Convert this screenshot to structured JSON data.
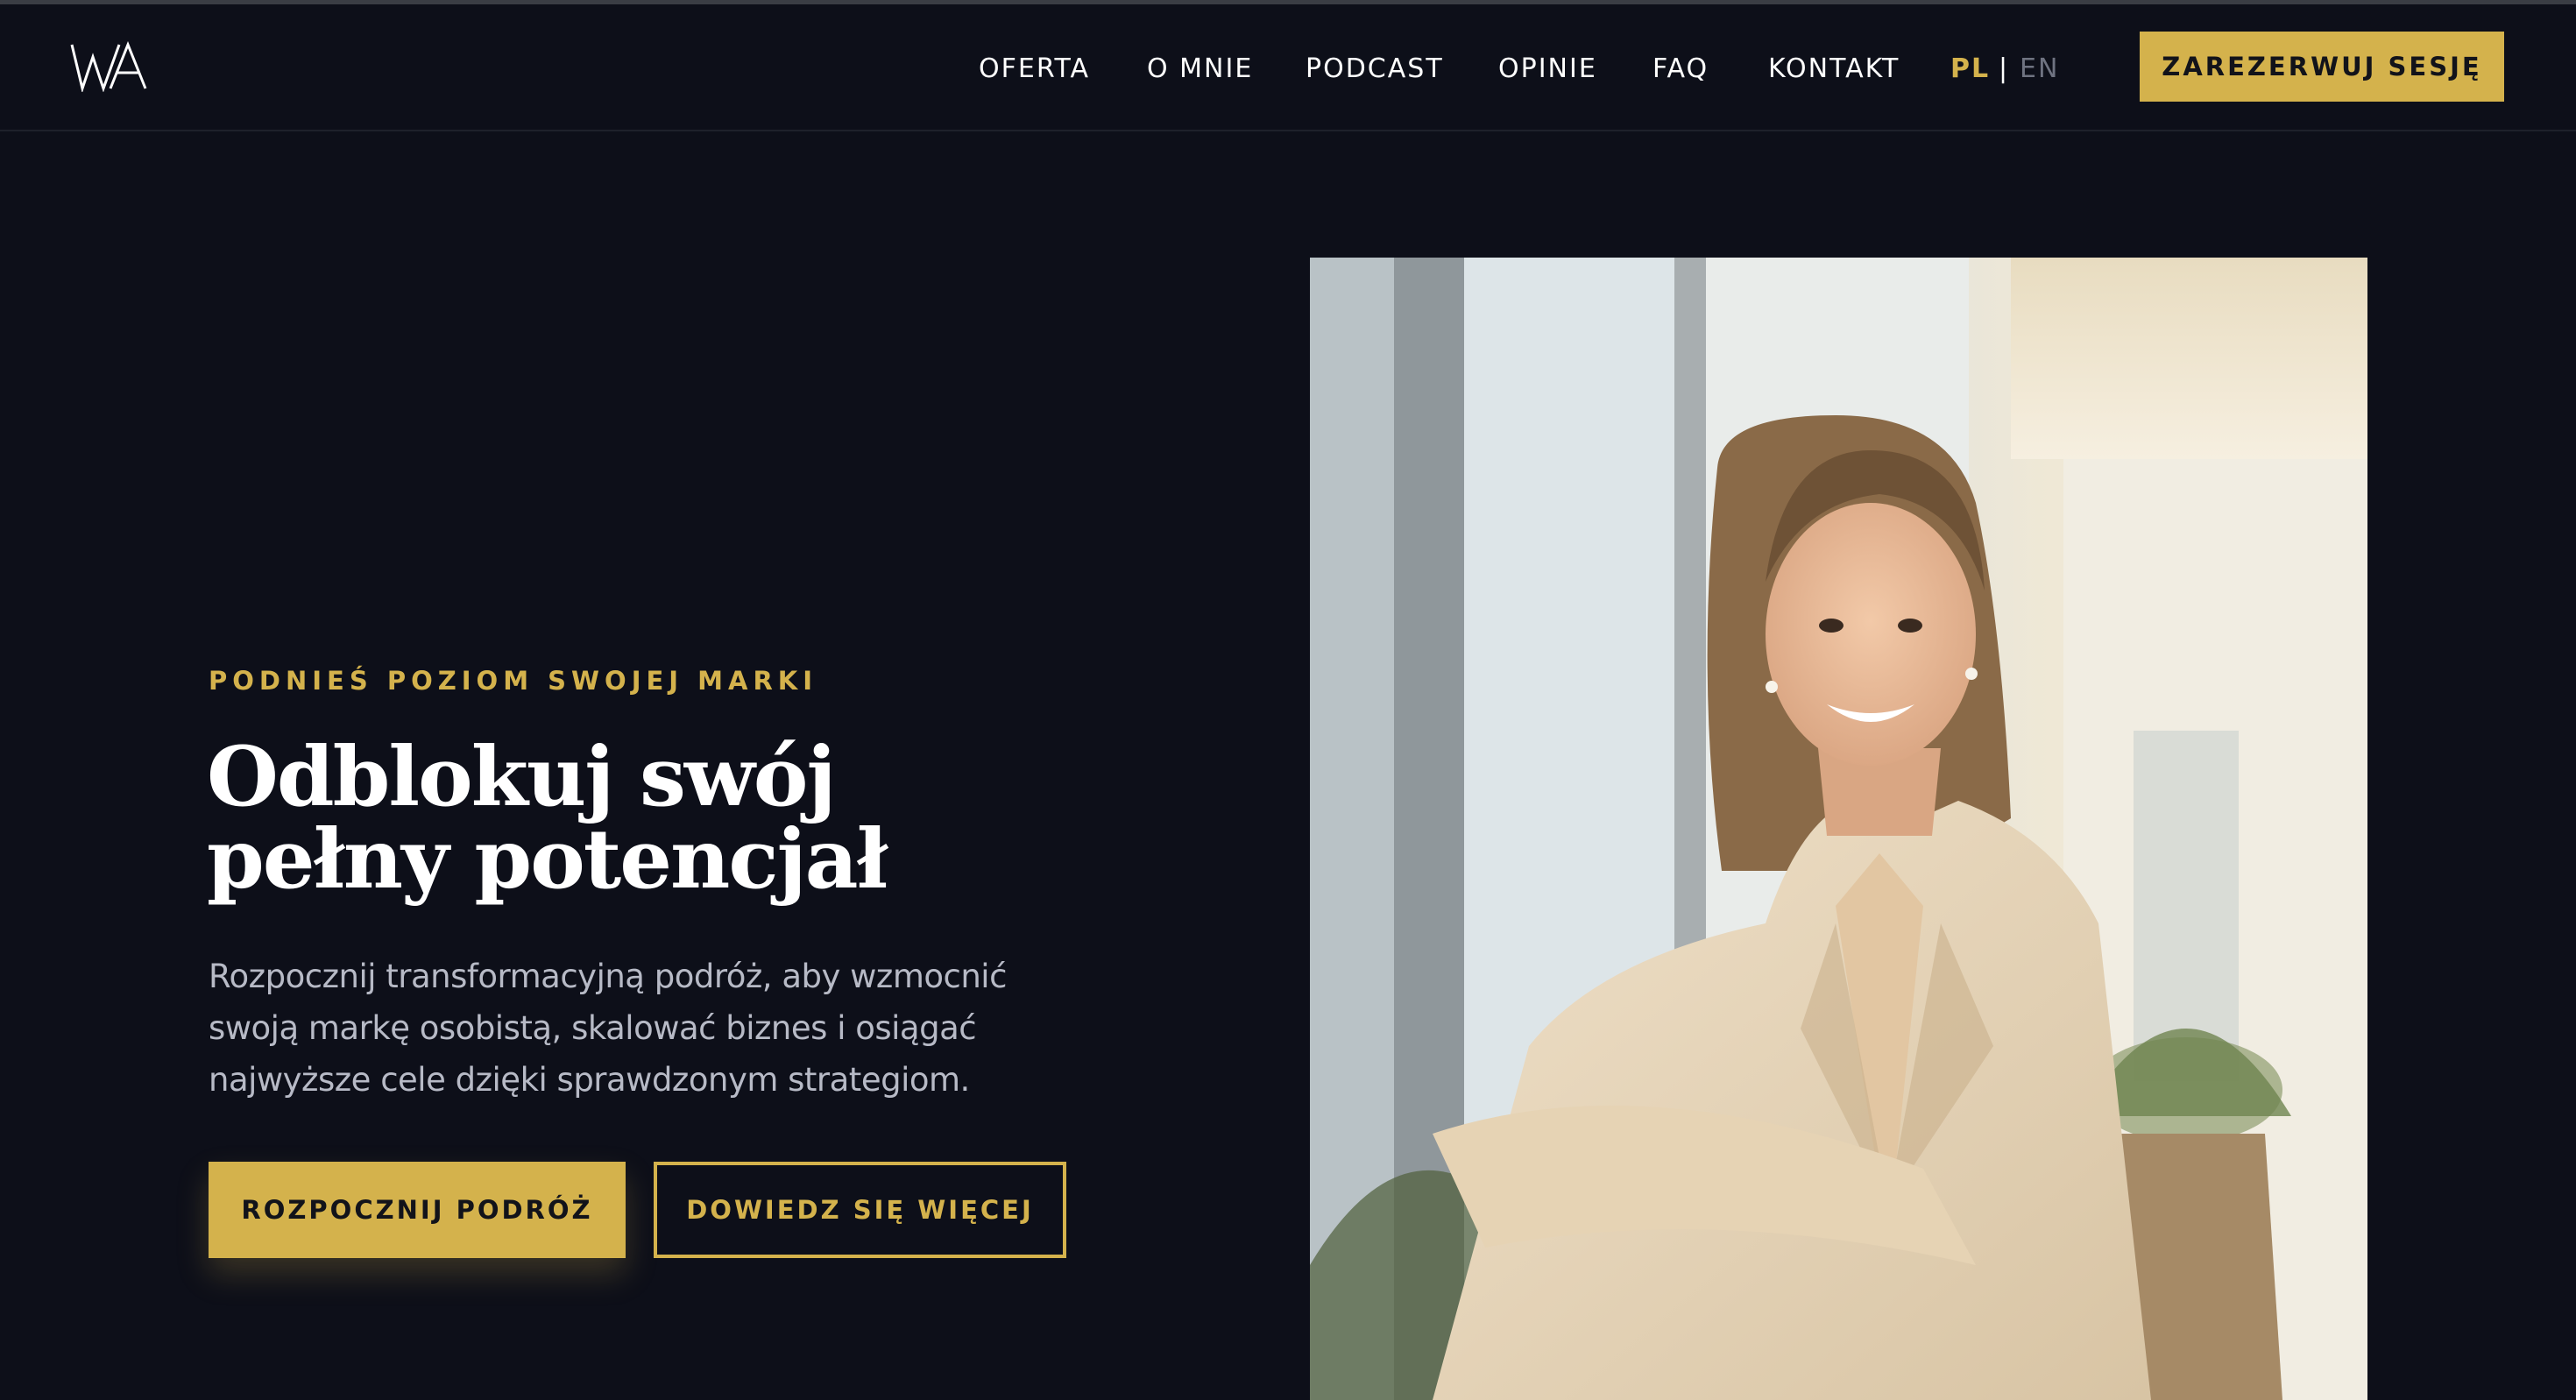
{
  "colors": {
    "background": "#0d0f19",
    "accent": "#d4b24c",
    "text": "#ffffff",
    "muted": "#b7bac6"
  },
  "header": {
    "logo_text": "WA",
    "logo_icon": "wa-monogram-logo",
    "nav": [
      {
        "label": "OFERTA"
      },
      {
        "label": "O MNIE"
      },
      {
        "label": "PODCAST"
      },
      {
        "label": "OPINIE"
      },
      {
        "label": "FAQ"
      },
      {
        "label": "KONTAKT"
      }
    ],
    "lang": {
      "active": "PL",
      "separator": "|",
      "other": "EN"
    },
    "cta_label": "ZAREZERWUJ SESJĘ"
  },
  "hero": {
    "eyebrow": "PODNIEŚ POZIOM SWOJEJ MARKI",
    "title_line1": "Odblokuj swój",
    "title_line2": "pełny potencjał",
    "lead": "Rozpocznij transformacyjną podróż, aby wzmocnić swoją markę osobistą, skalować biznes i osiągać najwyższe cele dzięki sprawdzonym strategiom.",
    "primary_button": "ROZPOCZNIJ PODRÓŻ",
    "secondary_button": "DOWIEDZ SIĘ WIĘCEJ",
    "photo_icon": "portrait-photo"
  }
}
